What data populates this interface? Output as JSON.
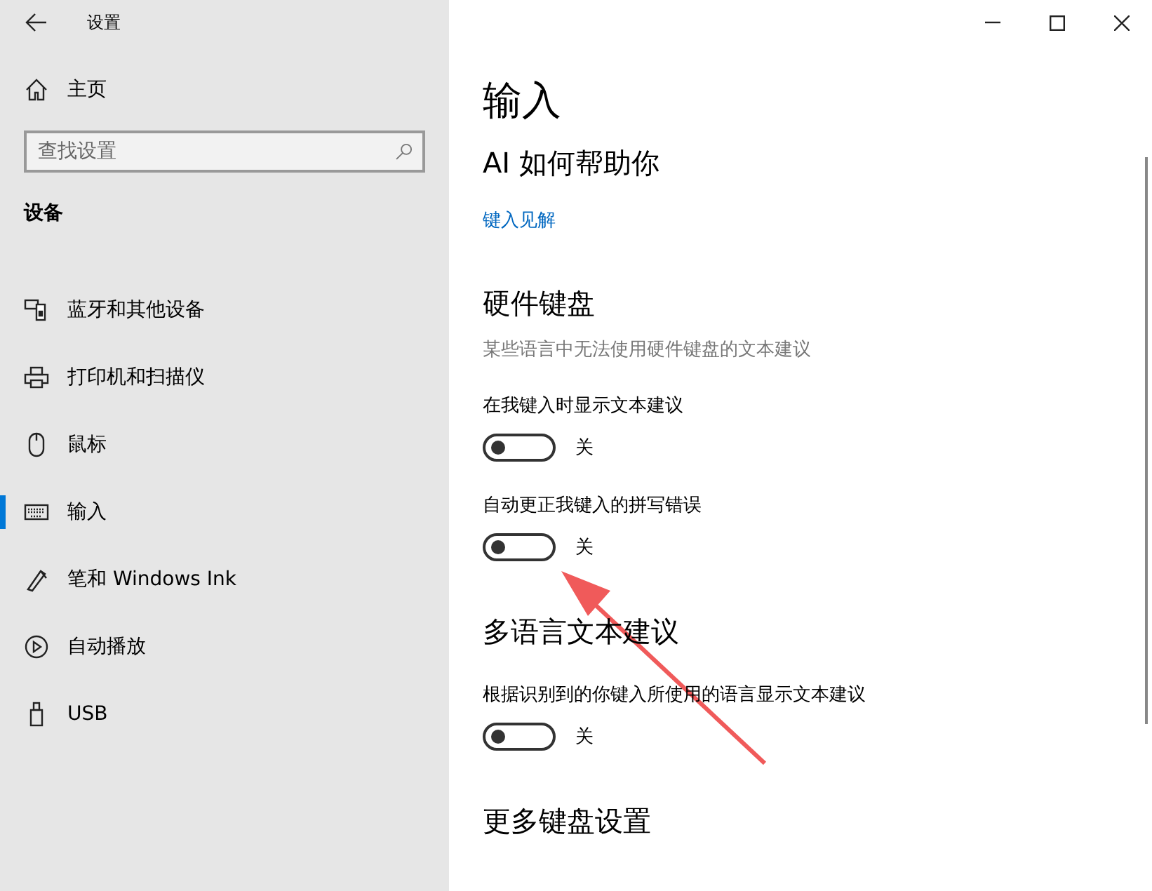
{
  "window": {
    "title": "设置"
  },
  "sidebar": {
    "home": "主页",
    "search": {
      "placeholder": "查找设置"
    },
    "group": "设备",
    "items": [
      {
        "label": "蓝牙和其他设备",
        "selected": false
      },
      {
        "label": "打印机和扫描仪",
        "selected": false
      },
      {
        "label": "鼠标",
        "selected": false
      },
      {
        "label": "输入",
        "selected": true
      },
      {
        "label": "笔和 Windows Ink",
        "selected": false
      },
      {
        "label": "自动播放",
        "selected": false
      },
      {
        "label": "USB",
        "selected": false
      }
    ]
  },
  "page": {
    "title": "输入",
    "sections": [
      {
        "heading": "AI 如何帮助你",
        "rows": [
          {
            "kind": "link",
            "text": "键入见解"
          }
        ]
      },
      {
        "heading": "硬件键盘",
        "description": "某些语言中无法使用硬件键盘的文本建议",
        "rows": [
          {
            "kind": "toggle",
            "label": "在我键入时显示文本建议",
            "on": false,
            "state_text": "关"
          },
          {
            "kind": "toggle",
            "label": "自动更正我键入的拼写错误",
            "on": false,
            "state_text": "关"
          }
        ]
      },
      {
        "heading": "多语言文本建议",
        "rows": [
          {
            "kind": "toggle",
            "label": "根据识别到的你键入所使用的语言显示文本建议",
            "on": false,
            "state_text": "关"
          }
        ]
      },
      {
        "heading": "更多键盘设置"
      }
    ]
  }
}
